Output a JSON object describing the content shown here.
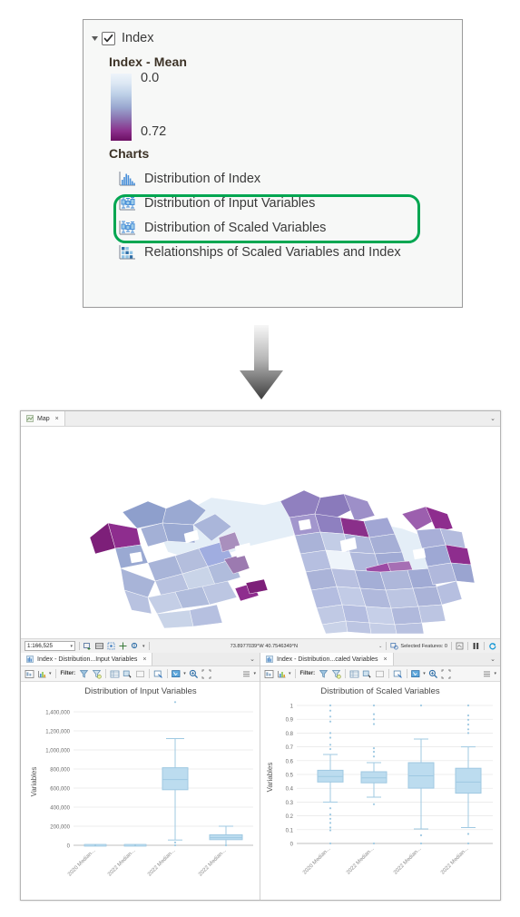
{
  "toc": {
    "layer": {
      "name": "Index",
      "checked": true,
      "expander_icon": "triangle-collapse-icon",
      "check_icon": "checkmark-icon"
    },
    "legend": {
      "title": "Index - Mean",
      "ramp_top_label": "0.0",
      "ramp_bottom_label": "0.72",
      "ramp_colors": [
        "#eef4fa",
        "#bfd2e8",
        "#9aa8d0",
        "#8b6fae",
        "#8b2f8b",
        "#6b0f63"
      ]
    },
    "charts_header": "Charts",
    "chart_items": [
      {
        "label": "Distribution of Index",
        "icon": "histogram-chart-icon",
        "highlighted": false
      },
      {
        "label": "Distribution of Input Variables",
        "icon": "boxplot-chart-icon",
        "highlighted": true
      },
      {
        "label": "Distribution of Scaled Variables",
        "icon": "boxplot-chart-icon",
        "highlighted": true
      },
      {
        "label": "Relationships of Scaled Variables and Index",
        "icon": "scatterplot-matrix-icon",
        "highlighted": false
      }
    ],
    "highlight_color": "#00a651"
  },
  "arrow": {
    "icon": "down-arrow-icon",
    "color_top": "#f2f2f2",
    "color_bottom": "#4a4a4a"
  },
  "app": {
    "map_tab": {
      "label": "Map",
      "icon": "map-view-icon",
      "close_label": "×"
    },
    "tabstrip_caret": "⌄",
    "statusbar": {
      "scale": "1:166,525",
      "scale_caret": "▾",
      "tools": [
        "add-data-icon",
        "basemap-icon",
        "select-icon",
        "navigate-icon",
        "bookmark-icon"
      ],
      "tools_caret": "▾",
      "coordinates": "73.8977039°W 40.7546349°N",
      "coordinates_caret": "⌄",
      "selected_features": "Selected Features: 0",
      "selected_icon": "selection-icon",
      "draw_icon": "draw-status-icon",
      "pause_icon": "pause-icon",
      "refresh_icon": "refresh-icon",
      "refresh_color": "#1c9ad6"
    },
    "panes": [
      {
        "tab_label": "Index - Distribution...Input Variables",
        "tab_icon": "chart-view-icon",
        "tab_close": "×",
        "tab_caret": "⌄",
        "toolbar": {
          "filter_label": "Filter:",
          "icons": [
            "chart-properties-icon",
            "chart-type-icon",
            "filter-extent-icon",
            "filter-selection-icon",
            "data-table-icon",
            "select-features-icon",
            "clear-selection-icon",
            "zoom-to-selection-icon",
            "pan-tool-icon",
            "zoom-tool-icon",
            "full-extent-icon",
            "menu-icon"
          ],
          "carets": [
            "▾",
            "▾",
            "▾"
          ]
        }
      },
      {
        "tab_label": "Index - Distribution...caled Variables",
        "tab_icon": "chart-view-icon",
        "tab_close": "×",
        "tab_caret": "⌄",
        "toolbar": {
          "filter_label": "Filter:",
          "icons": [
            "chart-properties-icon",
            "chart-type-icon",
            "filter-extent-icon",
            "filter-selection-icon",
            "data-table-icon",
            "select-features-icon",
            "clear-selection-icon",
            "zoom-to-selection-icon",
            "pan-tool-icon",
            "zoom-tool-icon",
            "full-extent-icon",
            "menu-icon"
          ],
          "carets": [
            "▾",
            "▾",
            "▾"
          ]
        }
      }
    ]
  },
  "chart_data": [
    {
      "type": "box",
      "title": "Distribution of Input Variables",
      "xlabel": "",
      "ylabel": "Variables",
      "ylim": [
        0,
        1400000
      ],
      "yticks": [
        0,
        200000,
        400000,
        600000,
        800000,
        1000000,
        1200000,
        1400000
      ],
      "ytick_labels": [
        "0",
        "200,000",
        "400,000",
        "600,000",
        "800,000",
        "1,000,000",
        "1,200,000",
        "1,400,000"
      ],
      "grid": true,
      "legend": "none",
      "categories": [
        "2020 Median...",
        "2022 Median...",
        "2022 Median...",
        "2022 Median..."
      ],
      "boxes": [
        {
          "category": "2020 Median...",
          "min": 0,
          "q1": 0,
          "median": 0,
          "q3": 0,
          "max": 0,
          "outliers": []
        },
        {
          "category": "2022 Median...",
          "min": 0,
          "q1": 0,
          "median": 0,
          "q3": 0,
          "max": 0,
          "outliers": []
        },
        {
          "category": "2022 Median...",
          "min": 55000,
          "q1": 580000,
          "median": 690000,
          "q3": 810000,
          "max": 1120000,
          "outliers": [
            30000,
            1350000
          ]
        },
        {
          "category": "2022 Median...",
          "min": 0,
          "q1": 55000,
          "median": 80000,
          "q3": 105000,
          "max": 200000,
          "outliers": []
        }
      ]
    },
    {
      "type": "box",
      "title": "Distribution of Scaled Variables",
      "xlabel": "",
      "ylabel": "Variables",
      "ylim": [
        0,
        1
      ],
      "yticks": [
        0,
        0.1,
        0.2,
        0.3,
        0.4,
        0.5,
        0.6,
        0.7,
        0.8,
        0.9,
        1
      ],
      "ytick_labels": [
        "0",
        "0.1",
        "0.2",
        "0.3",
        "0.4",
        "0.5",
        "0.6",
        "0.7",
        "0.8",
        "0.9",
        "1"
      ],
      "grid": true,
      "legend": "none",
      "categories": [
        "2020 Median...",
        "2022 Median...",
        "2022 Median...",
        "2022 Median..."
      ],
      "boxes": [
        {
          "category": "2020 Median...",
          "min": 0.3,
          "q1": 0.445,
          "median": 0.485,
          "q3": 0.53,
          "max": 0.645,
          "outliers": [
            0.0,
            0.105,
            0.115,
            0.13,
            0.16,
            0.195,
            0.21,
            0.255,
            0.68,
            0.7,
            0.715,
            0.8,
            0.88,
            0.91,
            1.0
          ]
        },
        {
          "category": "2022 Median...",
          "min": 0.335,
          "q1": 0.435,
          "median": 0.475,
          "q3": 0.515,
          "max": 0.585,
          "outliers": [
            0.0,
            0.285,
            0.63,
            0.665,
            0.69,
            0.845,
            0.875,
            0.93,
            1.0
          ]
        },
        {
          "category": "2022 Median...",
          "min": 0.105,
          "q1": 0.4,
          "median": 0.49,
          "q3": 0.585,
          "max": 0.755,
          "outliers": [
            0.0,
            0.06,
            1.0
          ]
        },
        {
          "category": "2022 Median...",
          "min": 0.115,
          "q1": 0.365,
          "median": 0.445,
          "q3": 0.545,
          "max": 0.7,
          "outliers": [
            0.0,
            0.065,
            0.755,
            0.8,
            0.815,
            0.845,
            0.875,
            0.9,
            1.0
          ]
        }
      ]
    }
  ]
}
